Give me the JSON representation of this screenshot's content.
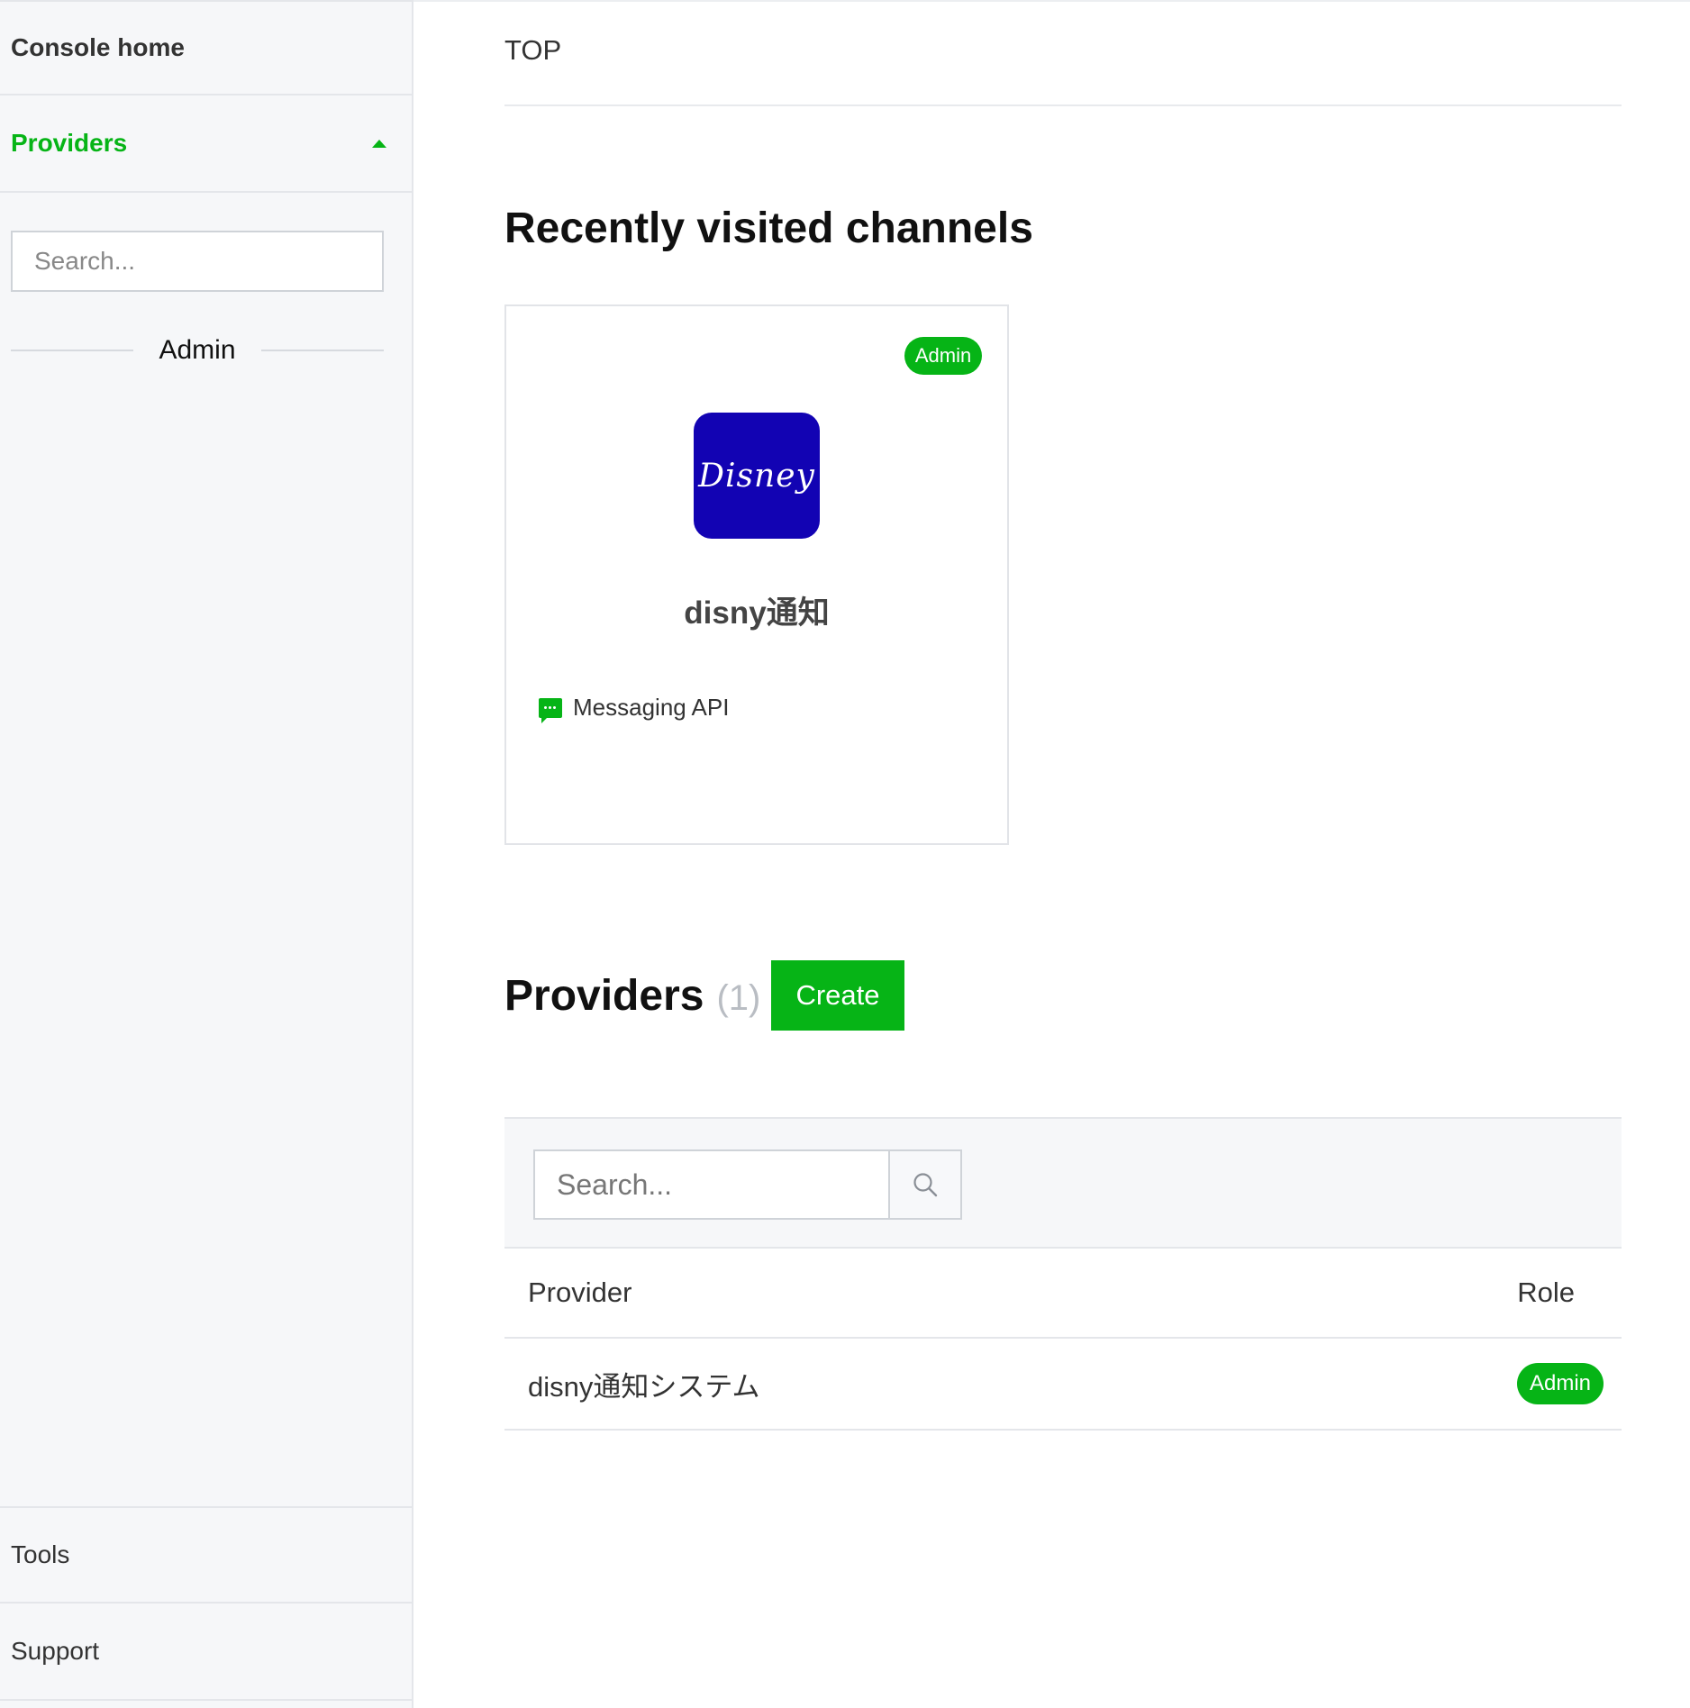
{
  "sidebar": {
    "console_home": "Console home",
    "providers_label": "Providers",
    "search_placeholder": "Search...",
    "section_label": "Admin",
    "tools_label": "Tools",
    "support_label": "Support"
  },
  "main": {
    "breadcrumb": "TOP",
    "recent_title": "Recently visited channels",
    "recent_channels": [
      {
        "role": "Admin",
        "icon_text": "Disney",
        "name": "disny通知",
        "type": "Messaging API"
      }
    ],
    "providers_title": "Providers",
    "providers_count": "(1)",
    "create_label": "Create",
    "filter_placeholder": "Search...",
    "table": {
      "headers": [
        "Provider",
        "Role"
      ],
      "rows": [
        {
          "provider": "disny通知システム",
          "role": "Admin"
        }
      ]
    }
  },
  "colors": {
    "accent": "#06b416",
    "icon_bg": "#1203b3",
    "sidebar_bg": "#f6f7f9"
  },
  "icons": {
    "providers_toggle": "caret-up-icon",
    "messaging": "chat-bubble-icon",
    "search": "magnifier-icon"
  }
}
